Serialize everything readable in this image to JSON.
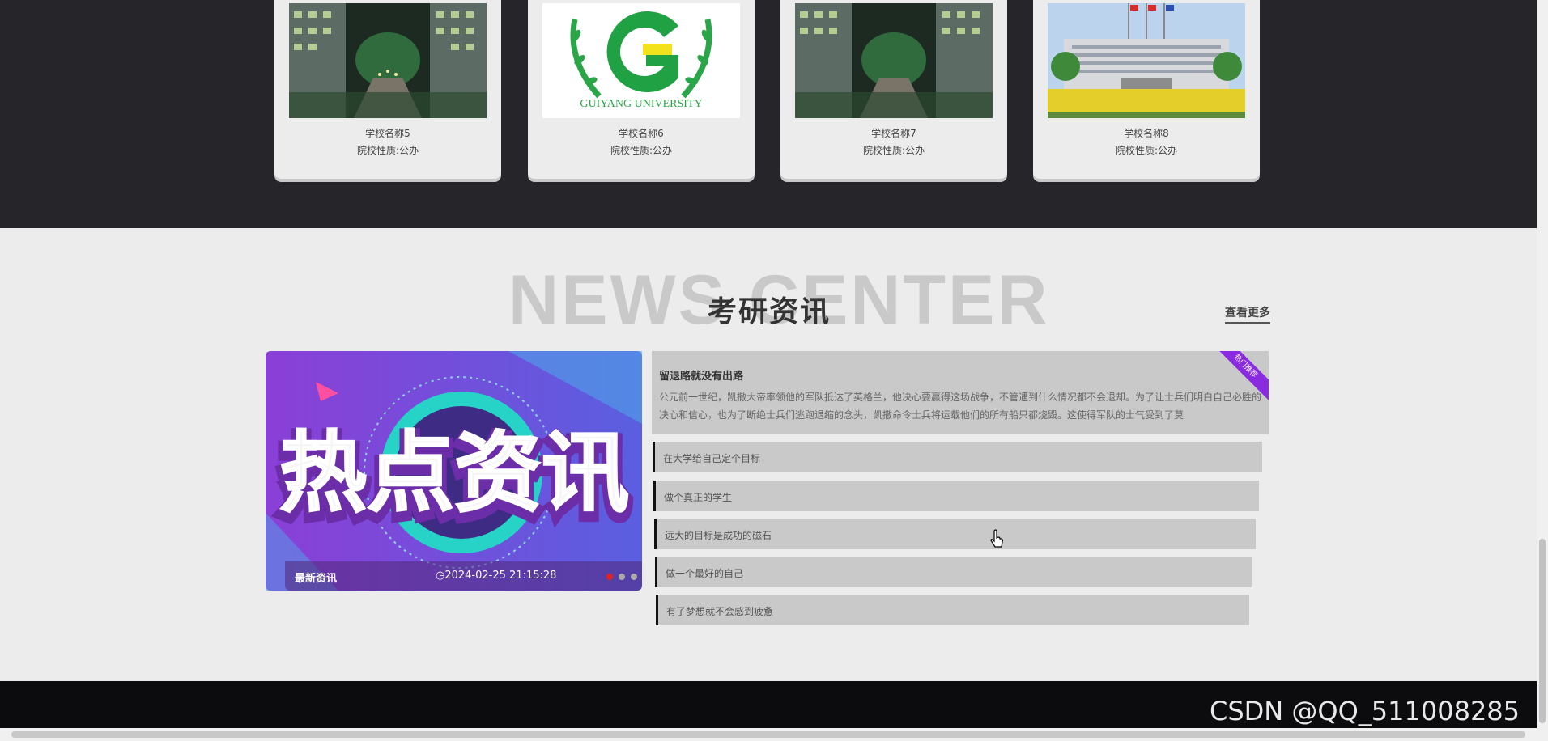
{
  "schools": [
    {
      "name": "学校名称5",
      "type": "院校性质:公办",
      "image": "campus-night-photo"
    },
    {
      "name": "学校名称6",
      "type": "院校性质:公办",
      "image": "university-logo",
      "logo_text": "GUIYANG UNIVERSITY"
    },
    {
      "name": "学校名称7",
      "type": "院校性质:公办",
      "image": "campus-night-photo"
    },
    {
      "name": "学校名称8",
      "type": "院校性质:公办",
      "image": "campus-building-photo"
    }
  ],
  "news": {
    "bg_word": "NEWS CENTER",
    "title": "考研资讯",
    "more_label": "查看更多",
    "banner": {
      "text": "热点资讯",
      "label": "最新资讯",
      "date": "2024-02-25 21:15:28",
      "active_slide": 1,
      "slide_count": 3
    },
    "featured": {
      "title": "留退路就没有出路",
      "text": "公元前一世纪，凯撒大帝率领他的军队抵达了英格兰，他决心要赢得这场战争，不管遇到什么情况都不会退却。为了让士兵们明白自己必胜的决心和信心，也为了断绝士兵们逃跑退缩的念头，凯撒命令士兵将运载他们的所有船只都烧毁。这使得军队的士气受到了莫",
      "ribbon": "热门推荐"
    },
    "items": [
      "在大学给自己定个目标",
      "做个真正的学生",
      "远大的目标是成功的磁石",
      "做一个最好的自己",
      "有了梦想就不会感到疲惫"
    ]
  },
  "watermark": "CSDN @QQ_511008285",
  "colors": {
    "dark_band": "#25252a",
    "page_bg": "#ececec",
    "list_bg": "#c9c9c9",
    "banner_purple": "#7b3fd8",
    "accent_red": "#e62020",
    "ribbon": "#8a2be2"
  }
}
